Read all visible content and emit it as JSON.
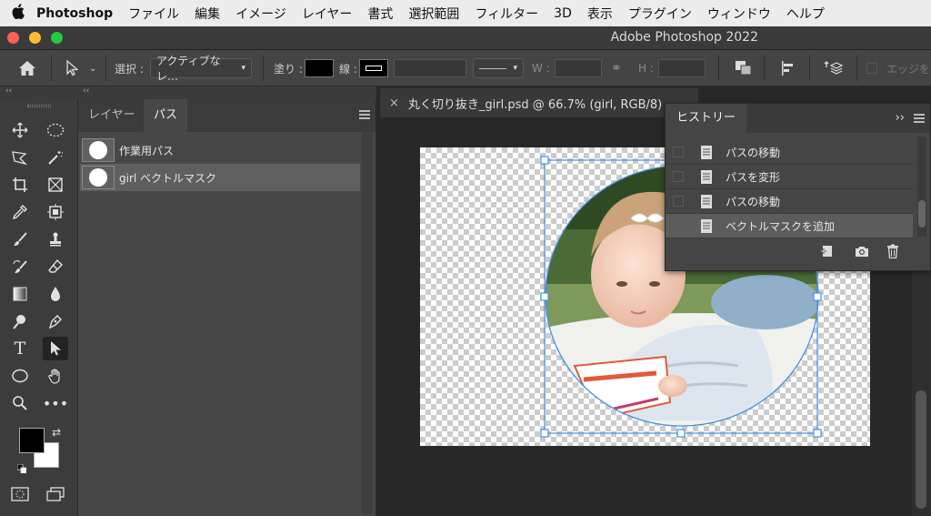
{
  "menubar": {
    "apple": "",
    "app": "Photoshop",
    "items": [
      "ファイル",
      "編集",
      "イメージ",
      "レイヤー",
      "書式",
      "選択範囲",
      "フィルター",
      "3D",
      "表示",
      "プラグイン",
      "ウィンドウ",
      "ヘルプ"
    ]
  },
  "window": {
    "title": "Adobe Photoshop 2022"
  },
  "options": {
    "select_label": "選択 :",
    "select_value": "アクティブなレ…",
    "fill_label": "塗り :",
    "stroke_label": "線 :",
    "w_label": "W :",
    "h_label": "H :",
    "edge_label": "エッジを"
  },
  "strip": {
    "left": "‹‹",
    "right": "‹‹"
  },
  "paths_panel": {
    "tabs": [
      "レイヤー",
      "パス"
    ],
    "rows": [
      "作業用パス",
      "girl ベクトルマスク"
    ]
  },
  "document": {
    "tab_close": "×",
    "tab_title": "丸く切り抜き_girl.psd @ 66.7% (girl, RGB/8)"
  },
  "history_panel": {
    "tab": "ヒストリー",
    "collapse": "››",
    "items": [
      "パスの移動",
      "パスを変形",
      "パスの移動",
      "ベクトルマスクを追加"
    ]
  },
  "colors": {
    "accent": "#4a90e2",
    "menubar_bg": "#ececec",
    "panel_bg": "#474747"
  }
}
